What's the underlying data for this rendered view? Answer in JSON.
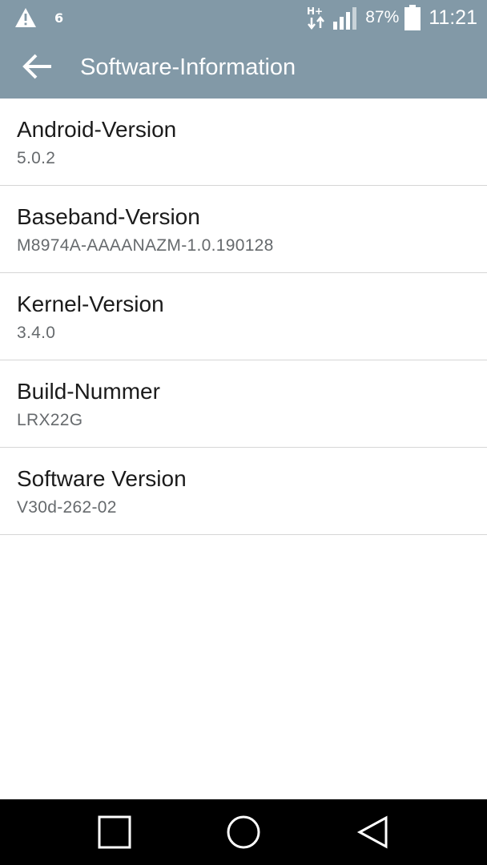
{
  "status_bar": {
    "left_icons": [
      "warning-icon"
    ],
    "notification_count": "6",
    "network_type": "H+",
    "battery_percent": "87%",
    "time": "11:21"
  },
  "app_bar": {
    "title": "Software-Information",
    "back_icon": "arrow-back-icon"
  },
  "items": [
    {
      "title": "Android-Version",
      "value": "5.0.2"
    },
    {
      "title": "Baseband-Version",
      "value": "M8974A-AAAANAZM-1.0.190128"
    },
    {
      "title": "Kernel-Version",
      "value": "3.4.0"
    },
    {
      "title": "Build-Nummer",
      "value": "LRX22G"
    },
    {
      "title": "Software Version",
      "value": "V30d-262-02"
    }
  ],
  "nav_bar": {
    "buttons": [
      "recents-icon",
      "home-icon",
      "back-icon"
    ]
  },
  "colors": {
    "app_bar": "#8299a7",
    "divider": "#d6d6d6",
    "title_text": "#1b1b1b",
    "value_text": "#666a6d",
    "nav_bar": "#000000"
  }
}
